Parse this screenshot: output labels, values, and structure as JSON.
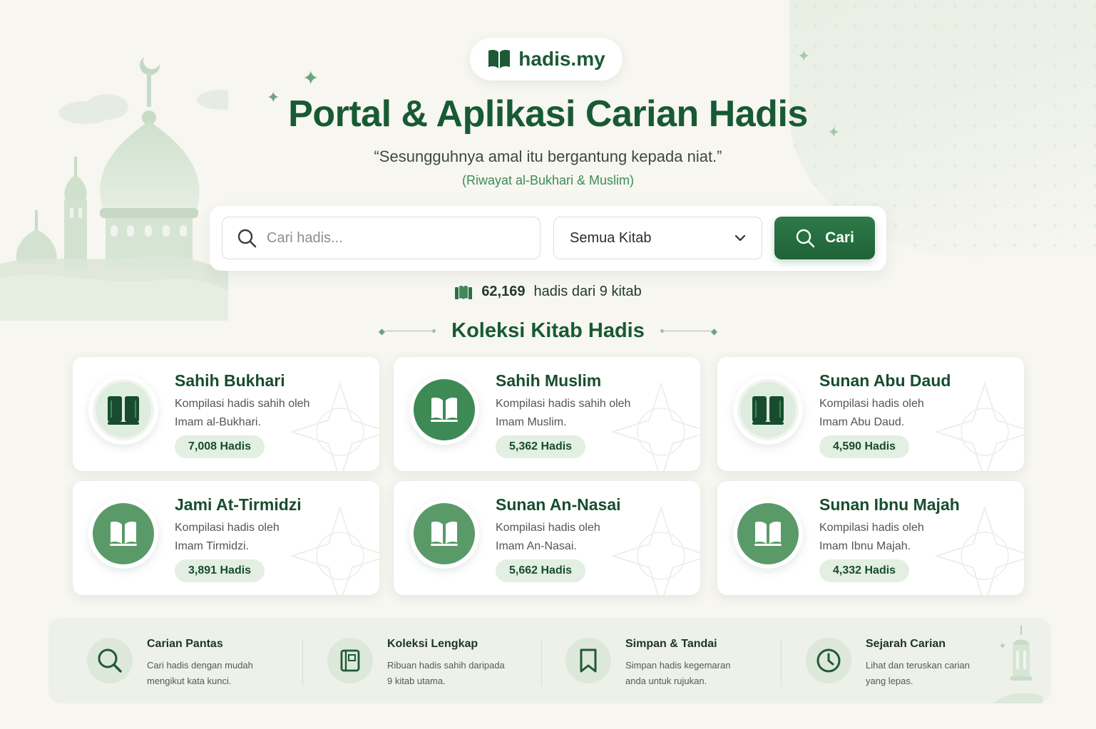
{
  "brand": {
    "name": "hadis.my",
    "logo_icon": "open-book-icon"
  },
  "hero": {
    "title": "Portal & Aplikasi Carian Hadis",
    "quote": "“Sesungguhnya amal itu bergantung kepada niat.”",
    "quote_source": "(Riwayat al-Bukhari & Muslim)"
  },
  "search": {
    "placeholder": "Cari hadis...",
    "value": "",
    "kitab_select": {
      "selected": "Semua Kitab",
      "icon": "chevron-down-icon"
    },
    "button_label": "Cari",
    "button_icon": "search-icon"
  },
  "stats": {
    "count": "62,169",
    "text": "hadis dari 9 kitab",
    "icon": "books-icon"
  },
  "collection": {
    "title": "Koleksi Kitab Hadis",
    "cards": [
      {
        "name": "Sahih Bukhari",
        "desc_line1": "Kompilasi hadis sahih oleh",
        "desc_line2": "Imam al-Bukhari.",
        "count": "7,008 Hadis",
        "icon": "closed-book-icon"
      },
      {
        "name": "Sahih Muslim",
        "desc_line1": "Kompilasi hadis sahih oleh",
        "desc_line2": "Imam Muslim.",
        "count": "5,362 Hadis",
        "icon": "open-book-icon"
      },
      {
        "name": "Sunan Abu Daud",
        "desc_line1": "Kompilasi hadis oleh",
        "desc_line2": "Imam Abu Daud.",
        "count": "4,590 Hadis",
        "icon": "closed-book-icon"
      },
      {
        "name": "Jami At-Tirmidzi",
        "desc_line1": "Kompilasi hadis oleh",
        "desc_line2": "Imam Tirmidzi.",
        "count": "3,891 Hadis",
        "icon": "open-book-icon"
      },
      {
        "name": "Sunan An-Nasai",
        "desc_line1": "Kompilasi hadis oleh",
        "desc_line2": "Imam An-Nasai.",
        "count": "5,662 Hadis",
        "icon": "open-book-icon"
      },
      {
        "name": "Sunan Ibnu Majah",
        "desc_line1": "Kompilasi hadis oleh",
        "desc_line2": "Imam Ibnu Majah.",
        "count": "4,332 Hadis",
        "icon": "open-book-icon"
      }
    ]
  },
  "features": [
    {
      "title": "Carian Pantas",
      "desc_line1": "Cari hadis dengan mudah",
      "desc_line2": "mengikut kata kunci.",
      "icon": "search-icon"
    },
    {
      "title": "Koleksi Lengkap",
      "desc_line1": "Ribuan hadis sahih daripada",
      "desc_line2": "9 kitab utama.",
      "icon": "book-icon"
    },
    {
      "title": "Simpan & Tandai",
      "desc_line1": "Simpan hadis kegemaran",
      "desc_line2": "anda untuk rujukan.",
      "icon": "bookmark-icon"
    },
    {
      "title": "Sejarah Carian",
      "desc_line1": "Lihat dan teruskan carian",
      "desc_line2": "yang lepas.",
      "icon": "clock-icon"
    }
  ],
  "colors": {
    "primary": "#1f6238",
    "primary_dark": "#175a33",
    "accent_light": "#e3efe3",
    "background": "#f7f6f1"
  }
}
